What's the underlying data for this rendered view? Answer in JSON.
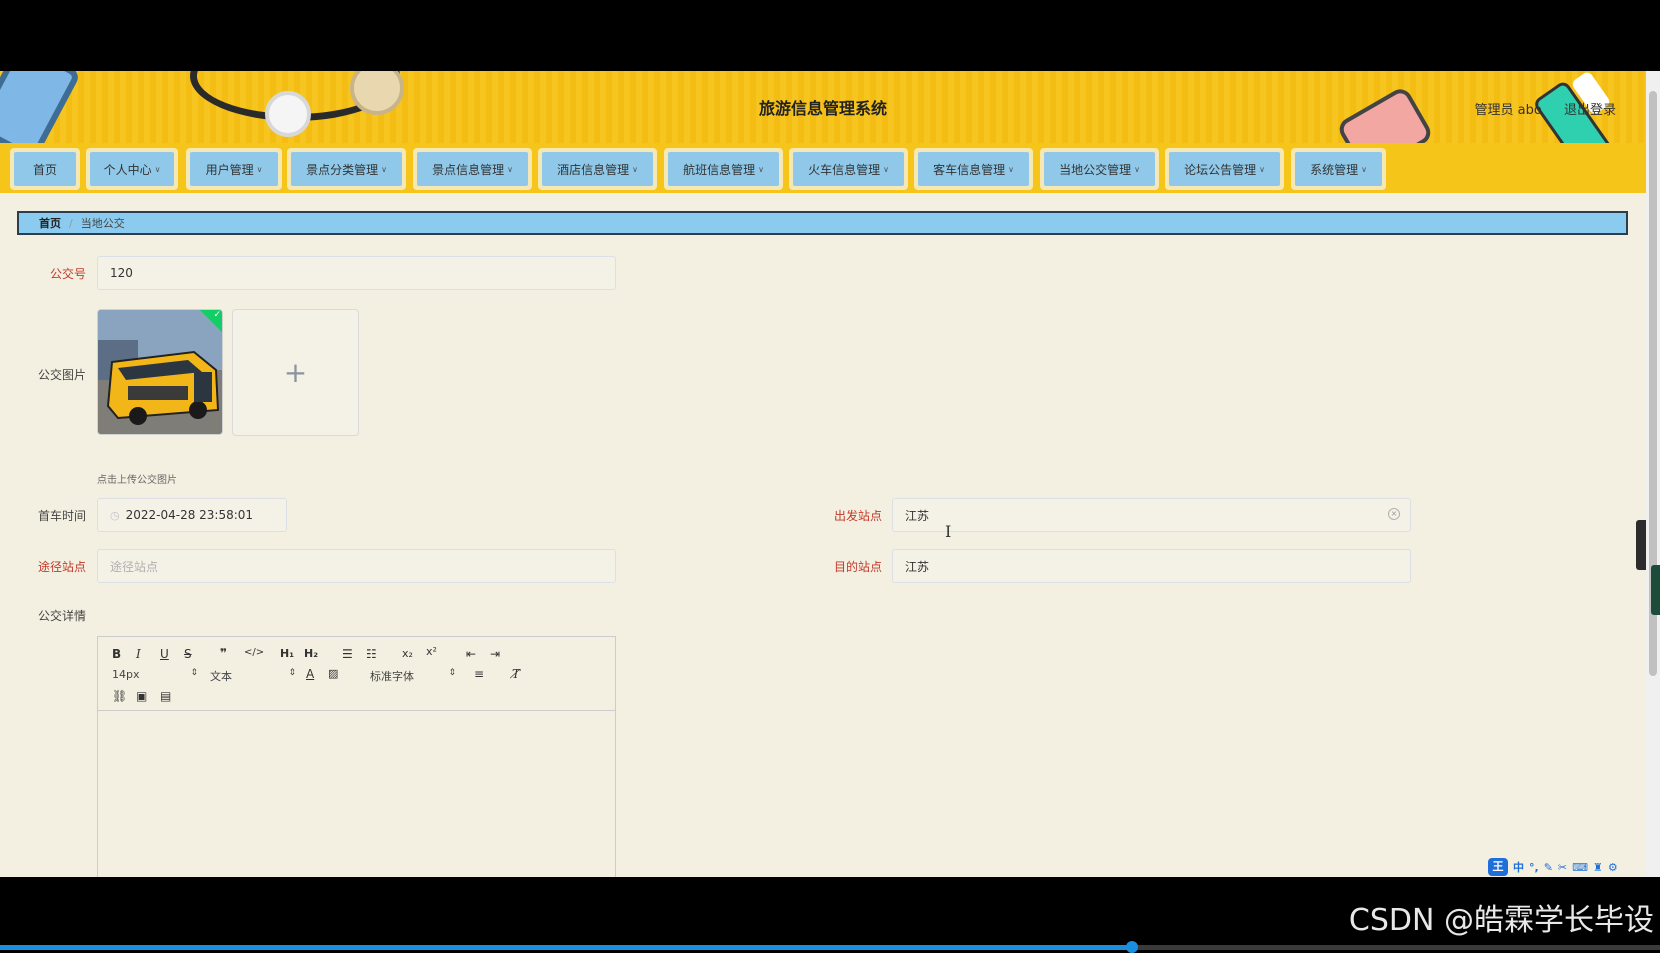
{
  "app": {
    "title": "旅游信息管理系统",
    "user_label": "管理员 abo",
    "logout_label": "退出登录"
  },
  "nav": [
    {
      "label": "首页",
      "has_dropdown": false
    },
    {
      "label": "个人中心",
      "has_dropdown": true
    },
    {
      "label": "用户管理",
      "has_dropdown": true
    },
    {
      "label": "景点分类管理",
      "has_dropdown": true
    },
    {
      "label": "景点信息管理",
      "has_dropdown": true
    },
    {
      "label": "酒店信息管理",
      "has_dropdown": true
    },
    {
      "label": "航班信息管理",
      "has_dropdown": true
    },
    {
      "label": "火车信息管理",
      "has_dropdown": true
    },
    {
      "label": "客车信息管理",
      "has_dropdown": true
    },
    {
      "label": "当地公交管理",
      "has_dropdown": true
    },
    {
      "label": "论坛公告管理",
      "has_dropdown": true
    },
    {
      "label": "系统管理",
      "has_dropdown": true
    }
  ],
  "breadcrumb": {
    "home": "首页",
    "separator": "/",
    "current": "当地公交"
  },
  "form": {
    "bus_no_label": "公交号",
    "bus_no_value": "120",
    "bus_image_label": "公交图片",
    "image_hint": "点击上传公交图片",
    "upload_plus": "+",
    "first_time_label": "首车时间",
    "first_time_value": "2022-04-28 23:58:01",
    "departure_label": "出发站点",
    "departure_value": "江苏",
    "via_label": "途径站点",
    "via_placeholder": "途径站点",
    "destination_label": "目的站点",
    "destination_value": "江苏",
    "detail_label": "公交详情"
  },
  "editor": {
    "font_size": "14px",
    "heading": "文本",
    "font_family": "标准字体"
  },
  "ime": {
    "logo": "王",
    "mode": "中"
  },
  "watermark": "CSDN @皓霖学长毕设",
  "video_progress": 0.682,
  "colors": {
    "header": "#f5c51a",
    "nav_button": "#8fc8e8",
    "breadcrumb": "#8ccbf0",
    "required_label": "#c0392b",
    "upload_success": "#13ce66"
  }
}
